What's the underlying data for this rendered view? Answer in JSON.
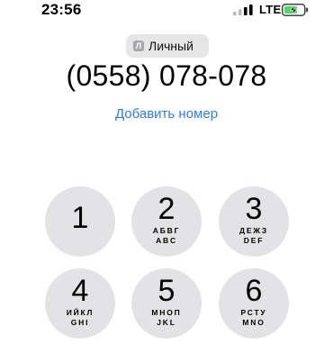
{
  "status": {
    "time": "23:56",
    "network": "LTE",
    "signal_icon": "cellular-signal-icon",
    "battery_icon": "battery-charging-icon",
    "battery_color": "#4cd964"
  },
  "line": {
    "icon_letter": "Л",
    "label": "Личный"
  },
  "number": "(0558) 078-078",
  "add_number_label": "Добавить номер",
  "accent_color": "#2f7ee6",
  "keypad": [
    {
      "digit": "1",
      "cyr": "",
      "lat": ""
    },
    {
      "digit": "2",
      "cyr": "АБВГ",
      "lat": "ABC"
    },
    {
      "digit": "3",
      "cyr": "ДЕЖЗ",
      "lat": "DEF"
    },
    {
      "digit": "4",
      "cyr": "ИЙКЛ",
      "lat": "GHI"
    },
    {
      "digit": "5",
      "cyr": "МНОП",
      "lat": "JKL"
    },
    {
      "digit": "6",
      "cyr": "РСТУ",
      "lat": "MNO"
    }
  ]
}
